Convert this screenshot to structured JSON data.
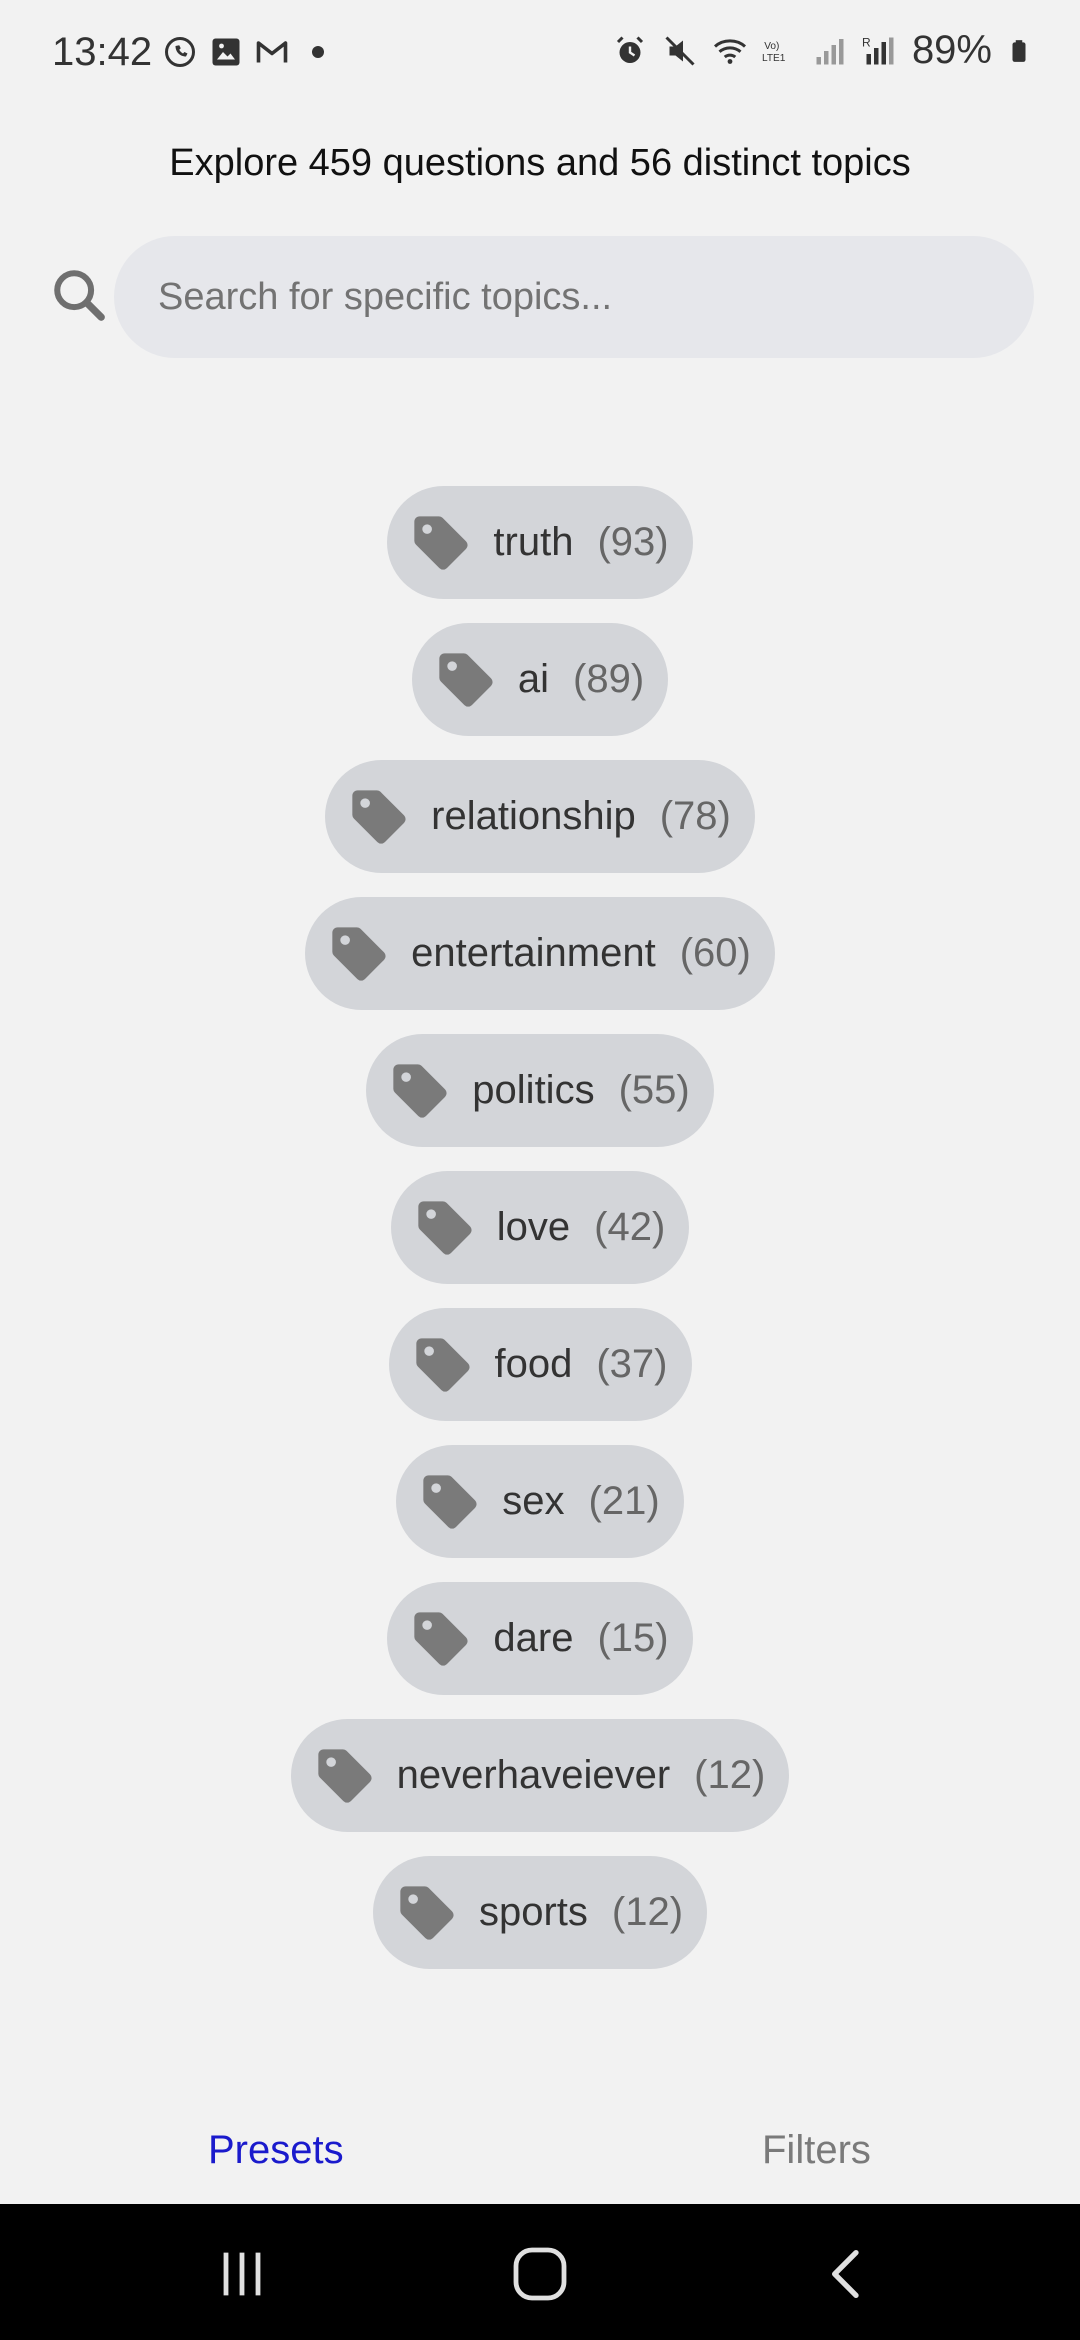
{
  "status_bar": {
    "time": "13:42",
    "battery": "89%",
    "left_icons": [
      "whatsapp-icon",
      "gallery-icon",
      "gmail-icon",
      "dot-icon"
    ],
    "right_icons": [
      "alarm-icon",
      "mute-icon",
      "wifi-icon",
      "volte-icon",
      "signal-icon",
      "signal-roaming-icon",
      "battery-icon"
    ]
  },
  "header": {
    "headline": "Explore 459 questions and 56 distinct topics"
  },
  "search": {
    "placeholder": "Search for specific topics...",
    "value": ""
  },
  "topics": [
    {
      "name": "truth",
      "count": "(93)"
    },
    {
      "name": "ai",
      "count": "(89)"
    },
    {
      "name": "relationship",
      "count": "(78)"
    },
    {
      "name": "entertainment",
      "count": "(60)"
    },
    {
      "name": "politics",
      "count": "(55)"
    },
    {
      "name": "love",
      "count": "(42)"
    },
    {
      "name": "food",
      "count": "(37)"
    },
    {
      "name": "sex",
      "count": "(21)"
    },
    {
      "name": "dare",
      "count": "(15)"
    },
    {
      "name": "neverhaveiever",
      "count": "(12)"
    },
    {
      "name": "sports",
      "count": "(12)"
    }
  ],
  "tabs": {
    "presets": "Presets",
    "filters": "Filters"
  },
  "colors": {
    "background": "#f2f2f2",
    "chip": "#d3d5d9",
    "tag_icon": "#7a7a7a",
    "active_tab": "#1a1acc",
    "inactive_tab": "#7a7a7a"
  }
}
